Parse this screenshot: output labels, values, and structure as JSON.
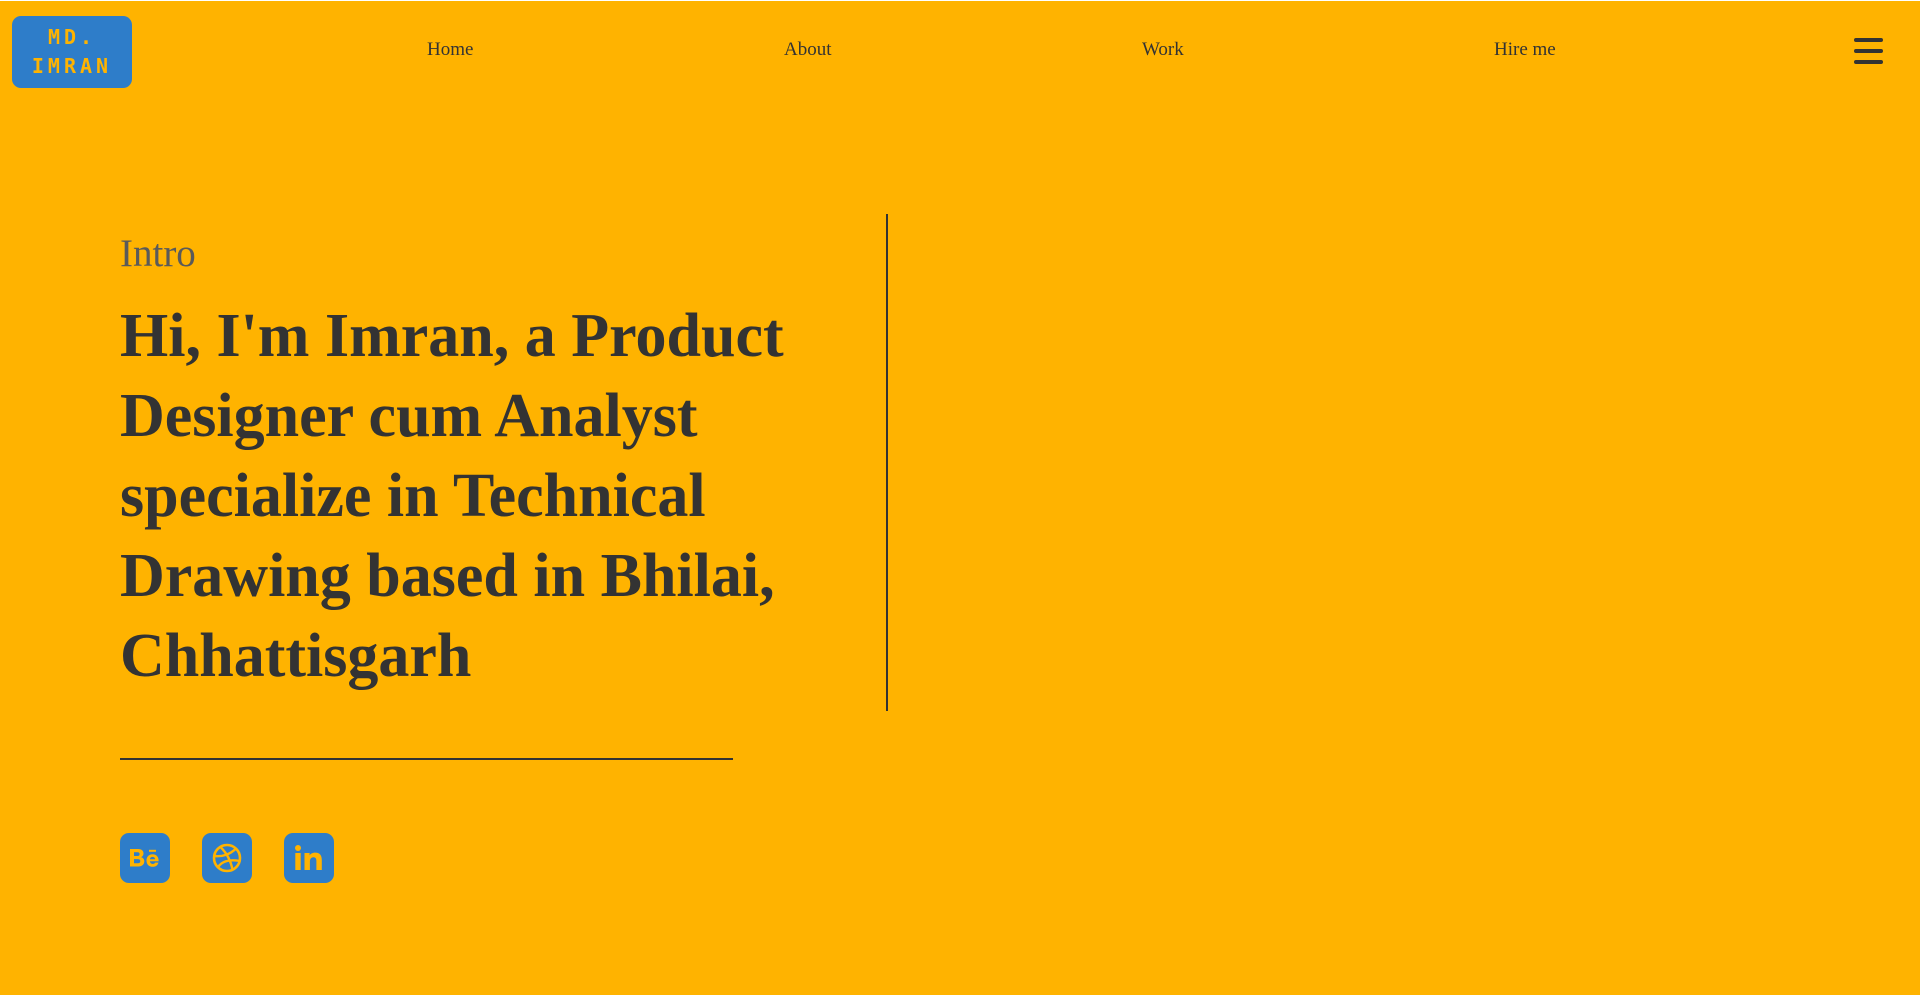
{
  "header": {
    "logo_line1": "MD.",
    "logo_line2": "IMRAN",
    "nav": [
      {
        "label": "Home"
      },
      {
        "label": "About"
      },
      {
        "label": "Work"
      },
      {
        "label": "Hire me"
      }
    ],
    "menu_icon": "hamburger-menu-icon"
  },
  "hero": {
    "intro_label": "Intro",
    "headline": "Hi, I'm Imran, a Product Designer cum Analyst specialize in Technical Drawing based in Bhilai, Chhattisgarh"
  },
  "socials": [
    {
      "icon": "behance-icon"
    },
    {
      "icon": "dribbble-icon"
    },
    {
      "icon": "linkedin-icon"
    }
  ],
  "colors": {
    "background": "#ffb300",
    "accent_blue": "#2e7dc9",
    "text_dark": "#333333",
    "text_muted": "#5a5a5a"
  }
}
